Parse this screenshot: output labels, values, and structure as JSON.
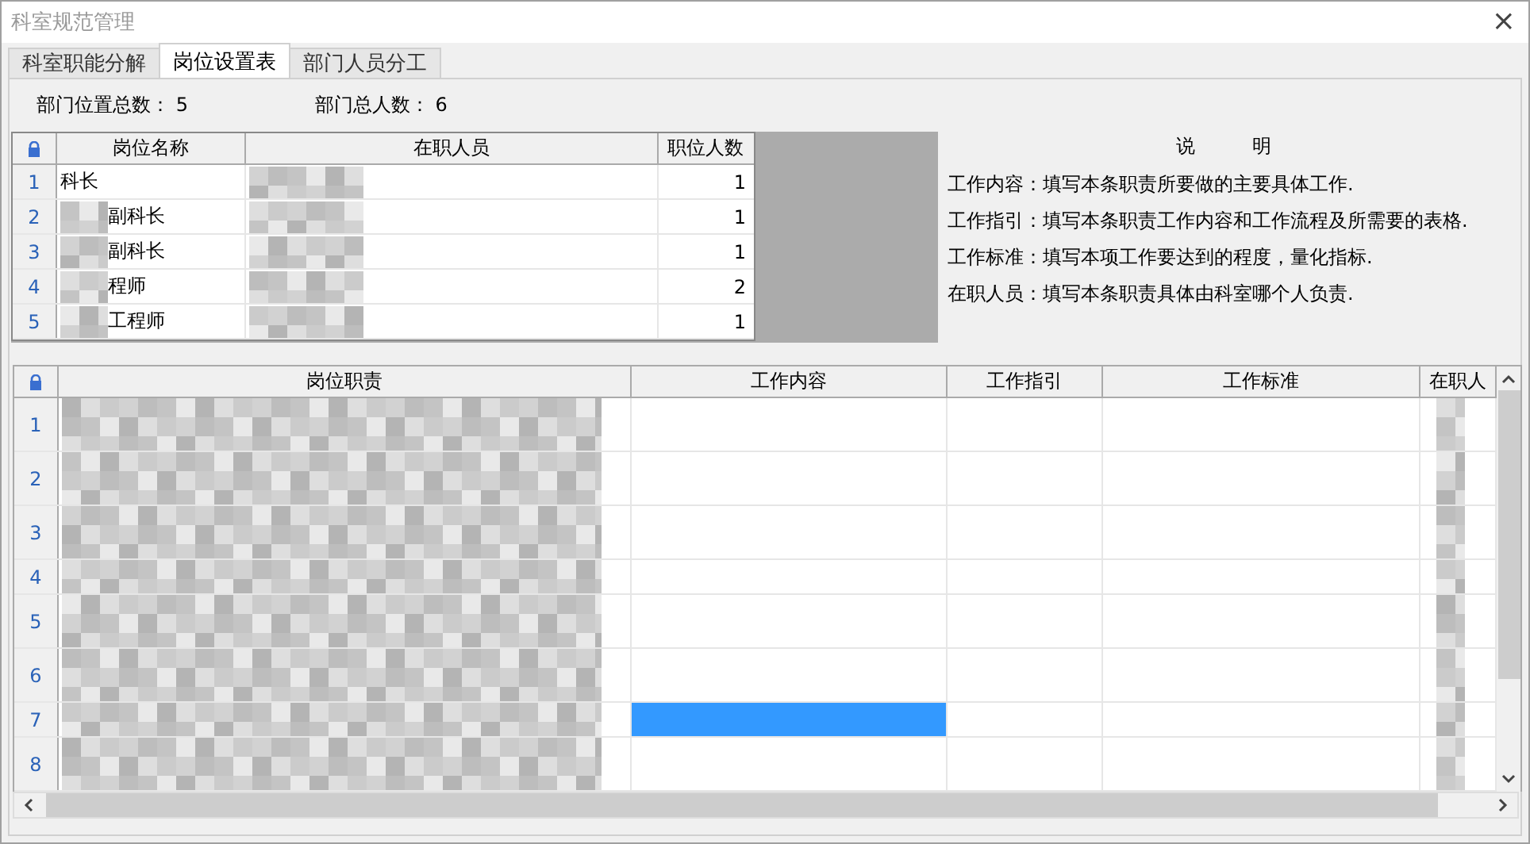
{
  "window": {
    "title": "科室规范管理",
    "close": "×"
  },
  "tabs": [
    {
      "label": "科室职能分解",
      "selected": false
    },
    {
      "label": "岗位设置表",
      "selected": true
    },
    {
      "label": "部门人员分工",
      "selected": false
    }
  ],
  "summary": [
    {
      "label": "部门位置总数：",
      "value": "5"
    },
    {
      "label": "部门总人数：",
      "value": "6"
    }
  ],
  "positions_table": {
    "columns": [
      "岗位名称",
      "在职人员",
      "职位人数"
    ],
    "rows": [
      {
        "number": "1",
        "name": "科长",
        "name_obscured": false,
        "staff_obscured": true,
        "count": "1"
      },
      {
        "number": "2",
        "name": "副科长",
        "name_obscured": true,
        "staff_obscured": true,
        "count": "1"
      },
      {
        "number": "3",
        "name": "副科长",
        "name_obscured": true,
        "staff_obscured": true,
        "count": "1"
      },
      {
        "number": "4",
        "name": "程师",
        "name_obscured": true,
        "staff_obscured": true,
        "count": "2"
      },
      {
        "number": "5",
        "name": "工程师",
        "name_obscured": true,
        "staff_obscured": true,
        "count": "1"
      }
    ]
  },
  "notes": {
    "title": "说　　　明",
    "lines": [
      "工作内容：填写本条职责所要做的主要具体工作.",
      "工作指引：填写本条职责工作内容和工作流程及所需要的表格.",
      "工作标准：填写本项工作要达到的程度，量化指标.",
      "在职人员：填写本条职责具体由科室哪个人负责."
    ]
  },
  "duties_table": {
    "columns": [
      "岗位职责",
      "工作内容",
      "工作指引",
      "工作标准",
      "在职人"
    ],
    "rows": [
      {
        "number": "1",
        "selected": false,
        "obscured": true,
        "tall": true
      },
      {
        "number": "2",
        "selected": false,
        "obscured": true,
        "tall": true
      },
      {
        "number": "3",
        "selected": false,
        "obscured": true,
        "tall": true
      },
      {
        "number": "4",
        "selected": false,
        "obscured": true,
        "tall": false
      },
      {
        "number": "5",
        "selected": false,
        "obscured": true,
        "tall": true
      },
      {
        "number": "6",
        "selected": false,
        "obscured": true,
        "tall": true
      },
      {
        "number": "7",
        "selected": true,
        "obscured": true,
        "tall": false
      },
      {
        "number": "8",
        "selected": false,
        "obscured": true,
        "tall": true
      }
    ]
  }
}
